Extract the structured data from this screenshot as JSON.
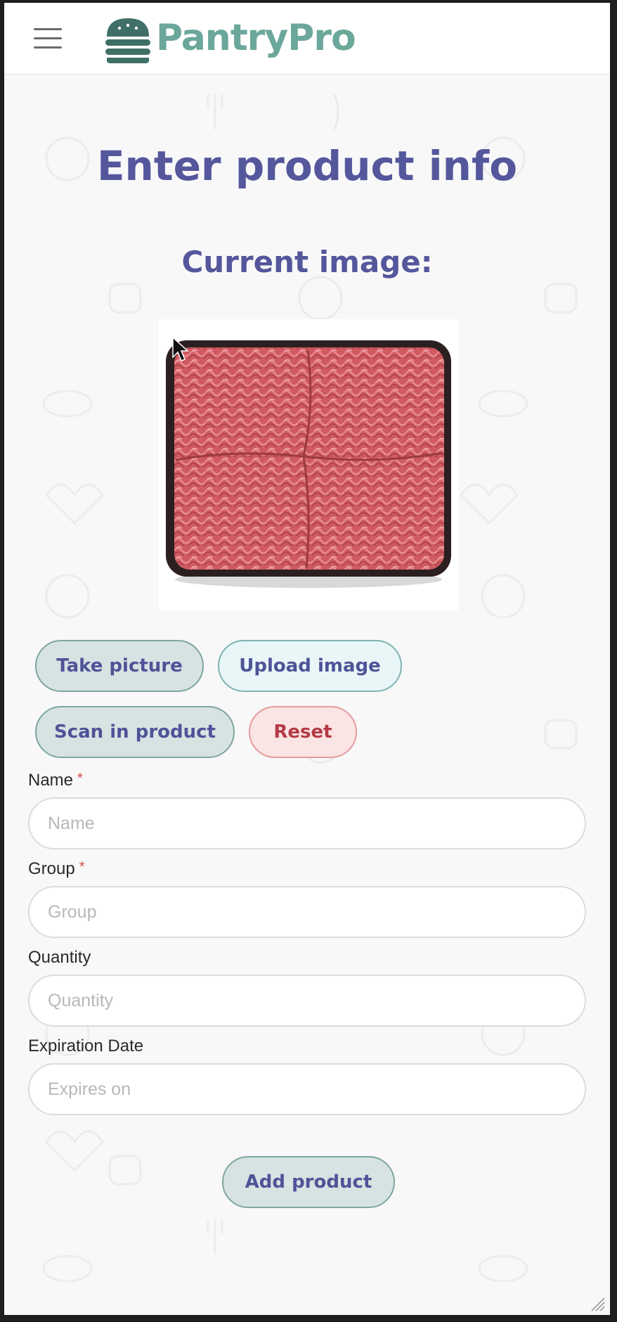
{
  "app": {
    "name": "PantryPro"
  },
  "header": {
    "menu_icon": "hamburger-menu-icon",
    "logo_icon": "burger-icon"
  },
  "page": {
    "title": "Enter product info",
    "subtitle": "Current image:"
  },
  "image": {
    "subject": "ground-beef-tray"
  },
  "buttons": {
    "take_picture": "Take picture",
    "upload_image": "Upload image",
    "scan_in_product": "Scan in product",
    "reset": "Reset",
    "add_product": "Add product"
  },
  "form": {
    "name": {
      "label": "Name",
      "required_mark": "*",
      "placeholder": "Name",
      "value": ""
    },
    "group": {
      "label": "Group",
      "required_mark": "*",
      "placeholder": "Group",
      "value": ""
    },
    "quantity": {
      "label": "Quantity",
      "placeholder": "Quantity",
      "value": ""
    },
    "expiration": {
      "label": "Expiration Date",
      "placeholder": "Expires on",
      "value": ""
    }
  },
  "colors": {
    "brand": "#6ba79b",
    "heading": "#55579c",
    "button_primary_bg": "#d6e3e2",
    "button_upload_bg": "#e8f6f7",
    "button_reset_bg": "#fbe4e4",
    "button_reset_text": "#b43a44"
  }
}
